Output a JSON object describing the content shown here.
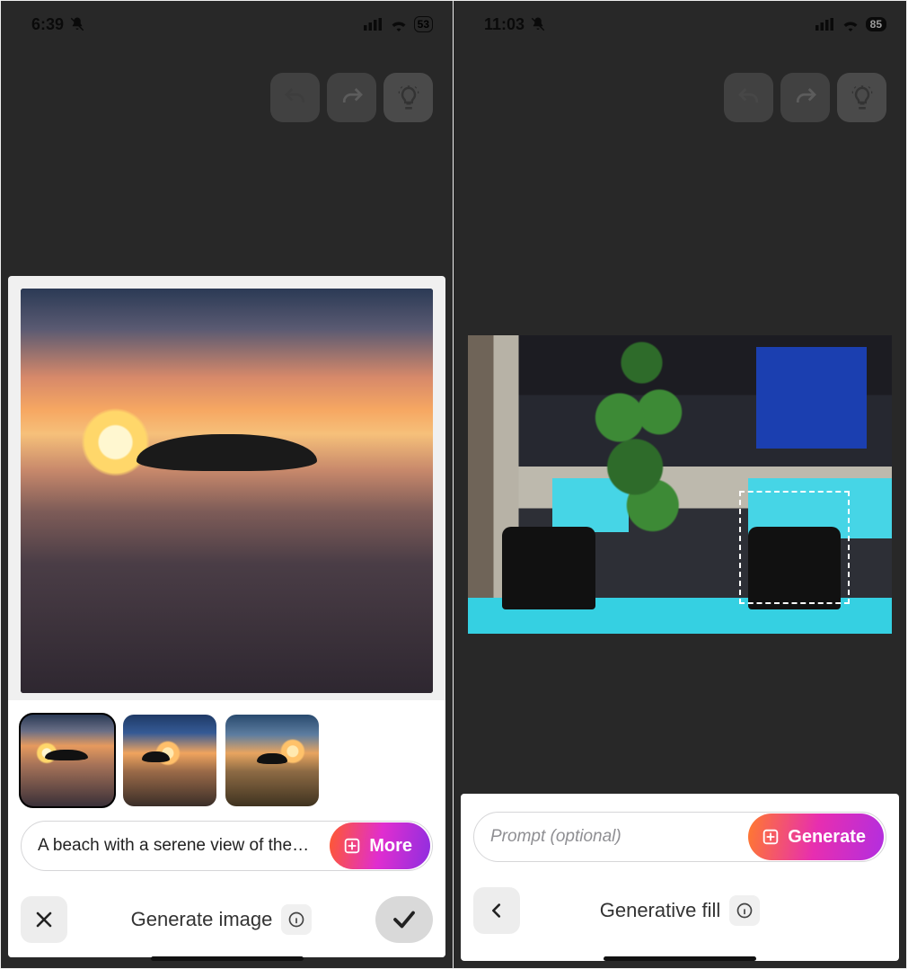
{
  "left": {
    "status": {
      "time": "6:39",
      "battery": "53"
    },
    "toolbar": {
      "undo": "undo",
      "redo": "redo",
      "idea": "idea"
    },
    "thumbs": {
      "count": 3,
      "selected_index": 0
    },
    "prompt": {
      "value_truncated": "A beach with a serene view of the s..."
    },
    "actions": {
      "more_label": "More"
    },
    "bottom": {
      "title": "Generate image",
      "close": "close",
      "confirm": "confirm"
    }
  },
  "right": {
    "status": {
      "time": "11:03",
      "battery": "85"
    },
    "toolbar": {
      "undo": "undo",
      "redo": "redo",
      "idea": "idea"
    },
    "selection_rect": {
      "note": "rectangular dashed selection over right-side chair area"
    },
    "prompt": {
      "placeholder": "Prompt (optional)"
    },
    "actions": {
      "generate_label": "Generate"
    },
    "bottom": {
      "title": "Generative fill",
      "back": "back"
    }
  }
}
